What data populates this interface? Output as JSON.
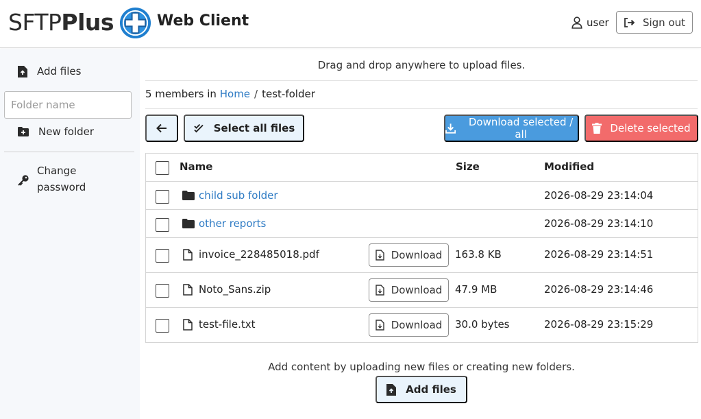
{
  "header": {
    "logo_prefix": "SFTP",
    "logo_suffix": "Plus",
    "app_name": "Web Client",
    "user_name": "user",
    "sign_out_label": "Sign out",
    "user_icon": "user-icon",
    "sign_out_icon": "sign-out-icon"
  },
  "sidebar": {
    "add_files_label": "Add files",
    "folder_name_placeholder": "Folder name",
    "new_folder_label": "New folder",
    "change_password_line1": "Change",
    "change_password_line2": "password"
  },
  "main": {
    "drag_hint": "Drag and drop anywhere to upload files.",
    "breadcrumb": {
      "count_text": "5 members in",
      "home_label": "Home",
      "separator": "/",
      "current_folder": "test-folder"
    },
    "toolbar": {
      "select_all_label": "Select all files",
      "download_selected_label": "Download selected / all",
      "delete_selected_label": "Delete selected"
    },
    "table": {
      "columns": {
        "name": "Name",
        "size": "Size",
        "modified": "Modified"
      },
      "rows": [
        {
          "type": "folder",
          "name": "child sub folder",
          "size": "",
          "modified": "2026-08-29 23:14:04"
        },
        {
          "type": "folder",
          "name": "other reports",
          "size": "",
          "modified": "2026-08-29 23:14:10"
        },
        {
          "type": "file",
          "name": "invoice_228485018.pdf",
          "download_label": "Download",
          "size": "163.8 KB",
          "modified": "2026-08-29 23:14:51"
        },
        {
          "type": "file",
          "name": "Noto_Sans.zip",
          "download_label": "Download",
          "size": "47.9 MB",
          "modified": "2026-08-29 23:14:46"
        },
        {
          "type": "file",
          "name": "test-file.txt",
          "download_label": "Download",
          "size": "30.0 bytes",
          "modified": "2026-08-29 23:15:29"
        }
      ]
    },
    "empty_hint": "Add content by uploading new files or creating new folders.",
    "add_files_label": "Add files"
  },
  "colors": {
    "link": "#2e7bc4",
    "primary": "#4a9bde",
    "danger": "#f26b6b",
    "light_button": "#eaf4fc",
    "sidebar_bg": "#f6f8fb"
  }
}
